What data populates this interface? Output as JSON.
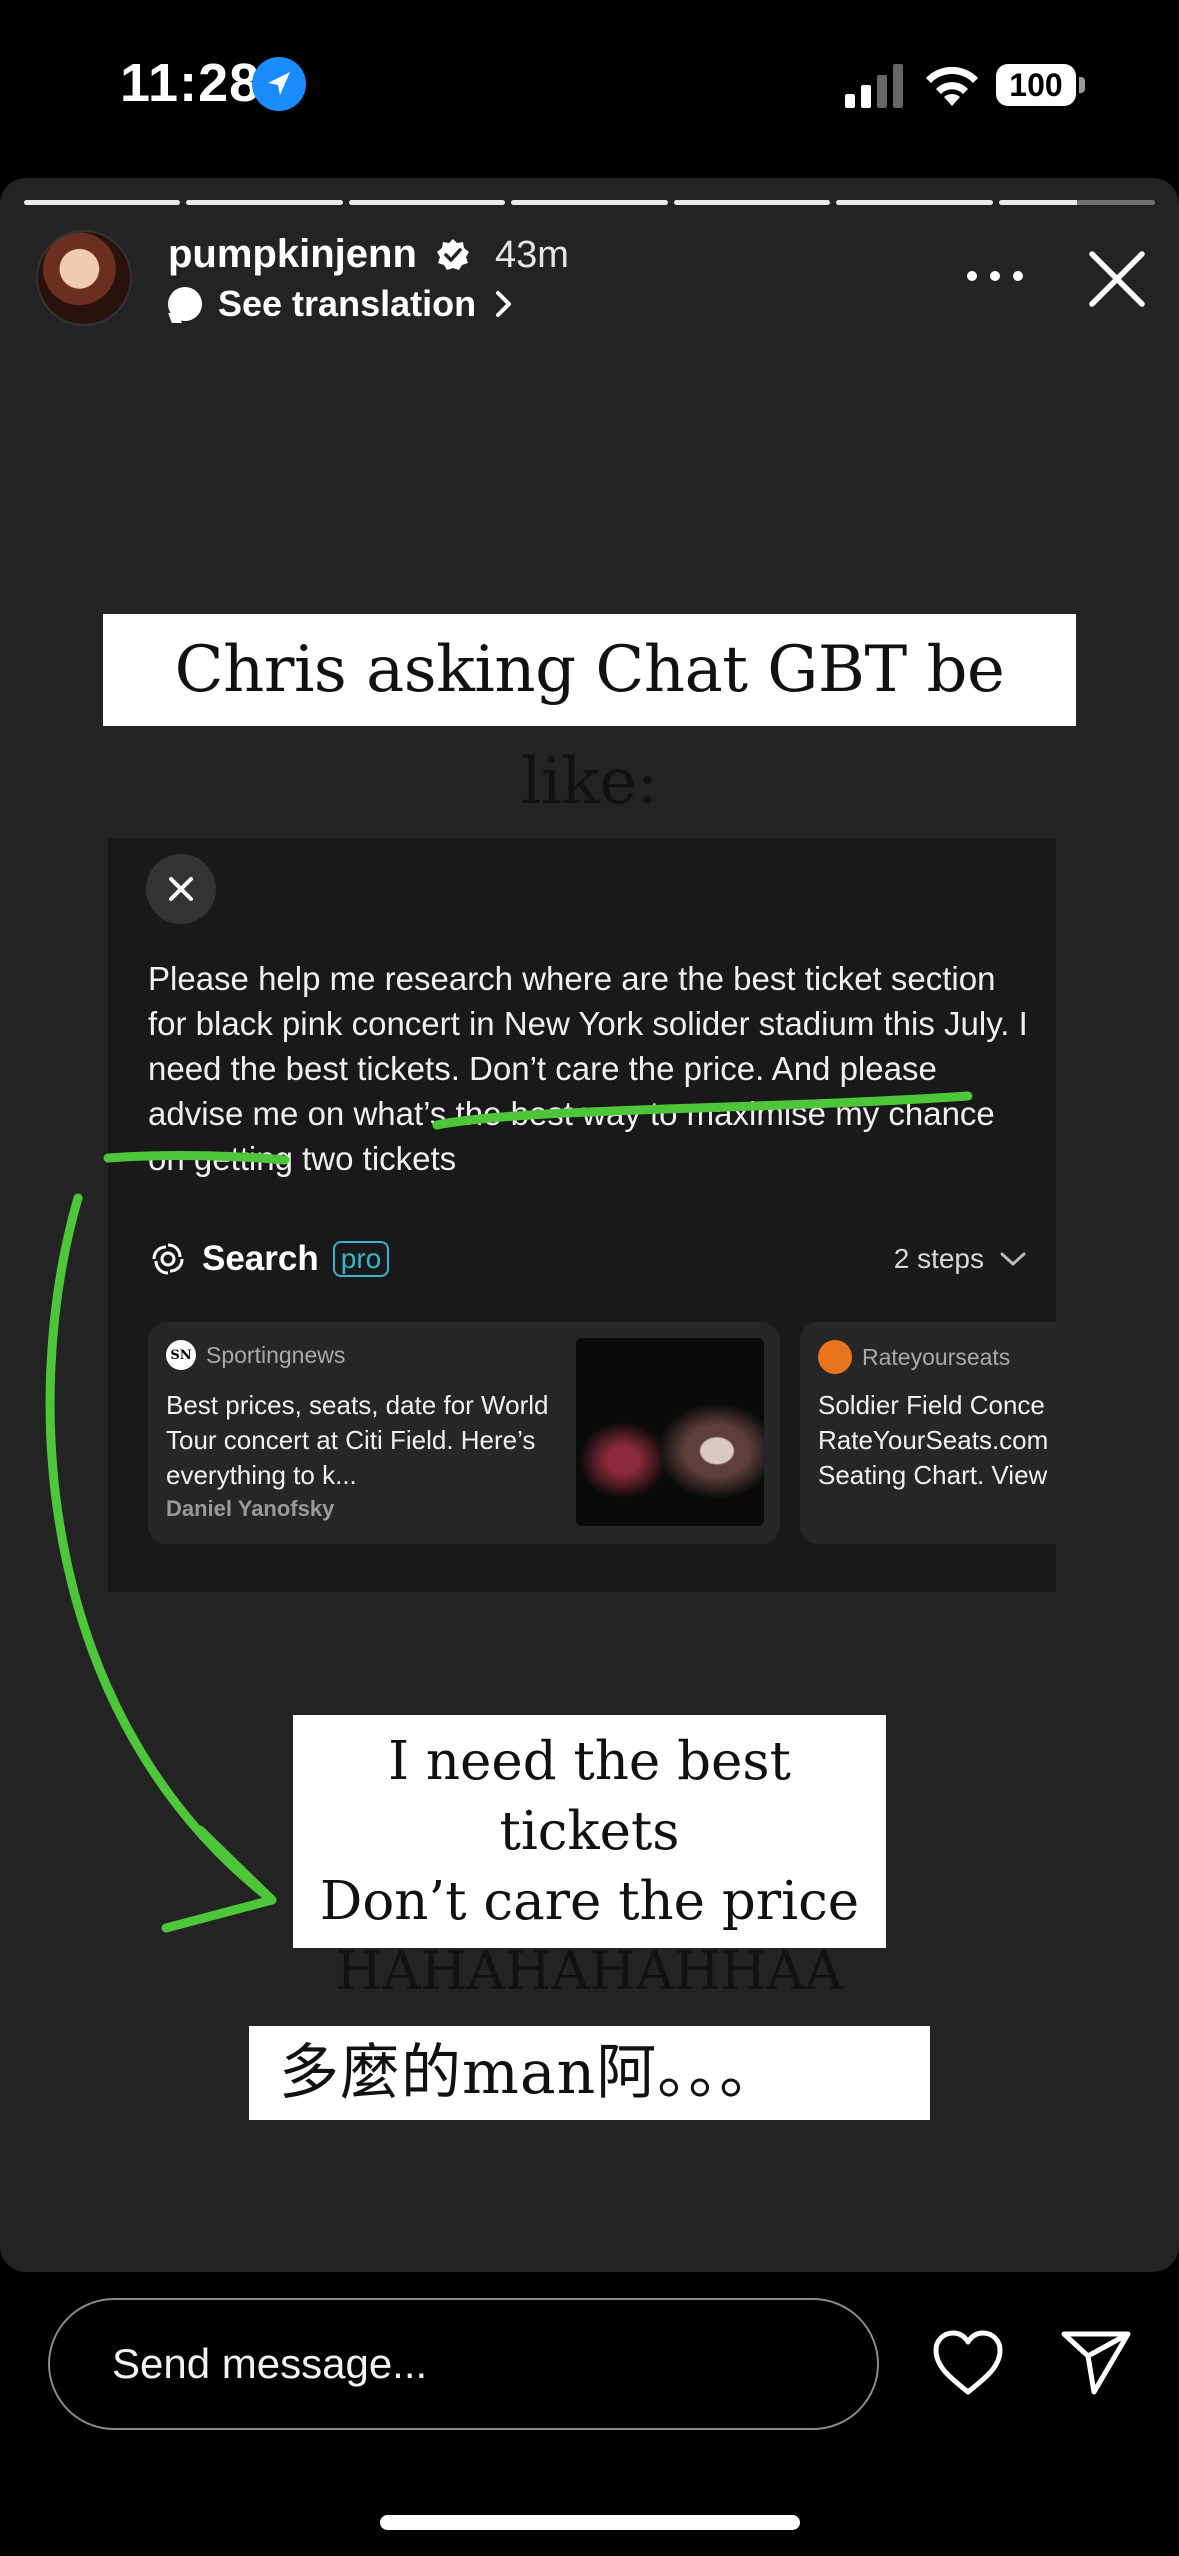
{
  "status_bar": {
    "time": "11:28",
    "battery": "100"
  },
  "story": {
    "progress_segments": 7,
    "current_segment_fill": 0.5,
    "username": "pumpkinjenn",
    "posted_ago": "43m",
    "translation_label": "See translation",
    "caption_top": "Chris asking Chat GBT be like:",
    "caption_middle": [
      "I need the best tickets",
      "Don’t care the price",
      "HAHAHAHAHHAA"
    ],
    "caption_bottom": "多麼的man阿。。。",
    "highlight_color": "#4ec63a"
  },
  "screenshot": {
    "prompt": "Please help me research where are the best ticket section for black pink concert in New York solider stadium this July. I need the best tickets. Don’t care the price. And please advise me on what’s the best way to maximise my chance on getting two tickets",
    "search_label": "Search",
    "pro_badge": "pro",
    "steps_label": "2 steps",
    "sources": [
      {
        "name": "Sportingnews",
        "logo": "SN",
        "title": "Best prices, seats, date for World Tour concert at Citi Field. Here’s everything to k...",
        "author": "Daniel Yanofsky"
      },
      {
        "name": "Rateyourseats",
        "title_lines": [
          "Soldier Field Conce",
          "RateYourSeats.com",
          "Seating Chart. View"
        ]
      }
    ]
  },
  "footer": {
    "message_placeholder": "Send message..."
  }
}
